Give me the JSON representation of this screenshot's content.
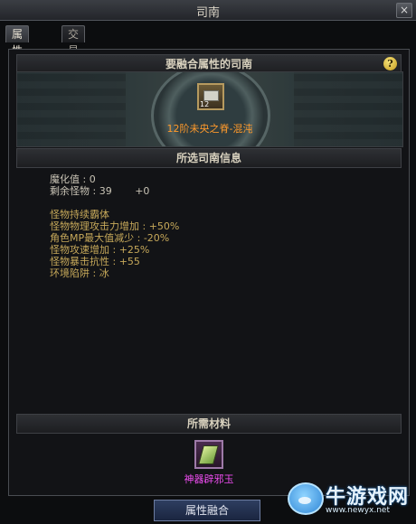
{
  "window": {
    "title": "司南"
  },
  "tabs": [
    {
      "label": "属性融合",
      "active": true
    },
    {
      "label": "交易类型变更",
      "active": false
    }
  ],
  "sections": {
    "target": {
      "header": "要融合属性的司南"
    },
    "info": {
      "header": "所选司南信息"
    },
    "materials": {
      "header": "所需材料"
    }
  },
  "selected_item": {
    "level": "12",
    "name": "12阶未央之脊-混沌",
    "icon": "chest-icon"
  },
  "info": {
    "stats": [
      {
        "label": "魔化值 : 0"
      },
      {
        "label": "剩余怪物 : 39",
        "extra": "+0"
      }
    ],
    "effects": [
      "怪物持续霸体",
      "怪物物理攻击力增加 : +50%",
      "角色MP最大值减少 : -20%",
      "怪物攻速增加 : +25%",
      "怪物暴击抗性 : +55",
      "环境陷阱 : 冰"
    ]
  },
  "material": {
    "name": "神器辟邪玉",
    "icon": "jade-icon"
  },
  "action": {
    "label": "属性融合"
  },
  "watermark": {
    "brand": "牛游戏网",
    "url": "www.newyx.net"
  },
  "colors": {
    "effect_text": "#c7a95a",
    "item_name": "#ff9a2b",
    "material_name": "#ee4cf0"
  }
}
